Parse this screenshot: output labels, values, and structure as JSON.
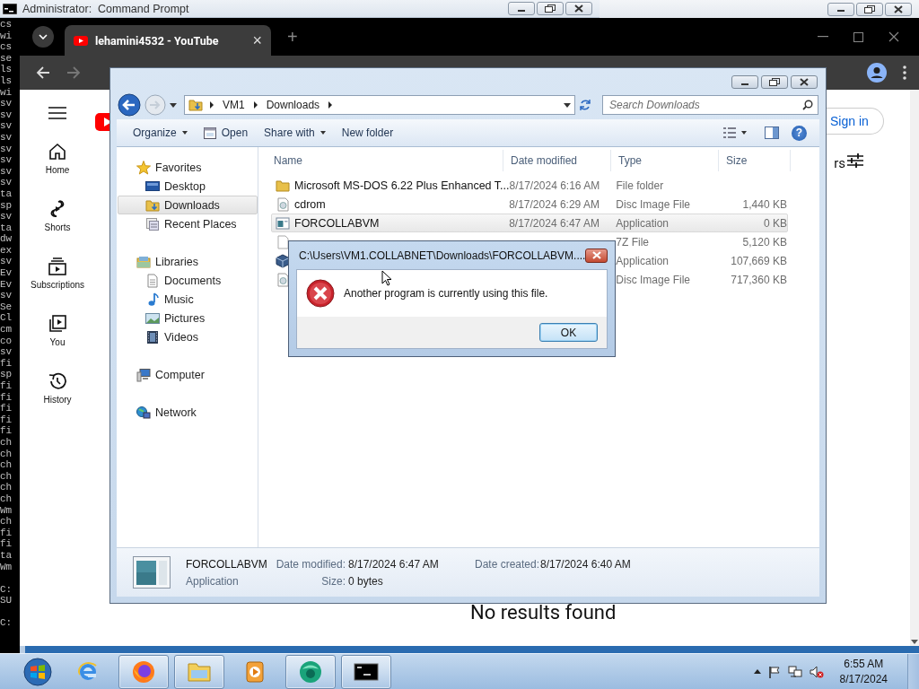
{
  "console": {
    "title": "Administrator:  Command Prompt",
    "lines": [
      {
        "text": "cs"
      },
      {
        "text": "wi"
      },
      {
        "text": "cs"
      },
      {
        "text": "se"
      },
      {
        "text": "ls"
      },
      {
        "text": "ls"
      },
      {
        "text": "wi"
      },
      {
        "text": "sv"
      },
      {
        "text": "sv"
      },
      {
        "text": "sv"
      },
      {
        "text": "sv"
      },
      {
        "text": "sv"
      },
      {
        "text": "sv"
      },
      {
        "text": "sv"
      },
      {
        "text": "sv"
      },
      {
        "text": "ta"
      },
      {
        "text": "sp"
      },
      {
        "text": "sv"
      },
      {
        "text": "ta"
      },
      {
        "text": "dw"
      },
      {
        "text": "ex"
      },
      {
        "text": "sv"
      },
      {
        "text": "Ev"
      },
      {
        "text": "Ev"
      },
      {
        "text": "sv"
      },
      {
        "text": "Se"
      },
      {
        "text": "Cl"
      },
      {
        "text": "cm"
      },
      {
        "text": "co"
      },
      {
        "text": "sv"
      },
      {
        "text": "fi"
      },
      {
        "text": "sp"
      },
      {
        "text": "fi"
      },
      {
        "text": "fi"
      },
      {
        "text": "fi"
      },
      {
        "text": "fi"
      },
      {
        "text": "fi"
      },
      {
        "text": "ch"
      },
      {
        "text": "ch"
      },
      {
        "text": "ch"
      },
      {
        "text": "ch"
      },
      {
        "text": "ch"
      },
      {
        "text": "ch"
      },
      {
        "text": "Wm"
      },
      {
        "text": "ch"
      },
      {
        "text": "fi"
      },
      {
        "text": "fi"
      },
      {
        "text": "ta"
      },
      {
        "text": "Wm"
      },
      {
        "text": "C:",
        "blank_before": true
      },
      {
        "text": "SU"
      },
      {
        "text": "C:",
        "blank_before": true
      }
    ]
  },
  "browser": {
    "tab": {
      "title": "lehamini4532 - YouTube",
      "close": "×"
    },
    "new_tab": "+",
    "sign_in": "Sign in",
    "filters": "rs",
    "sidebar": [
      {
        "kind": "home",
        "label": "Home"
      },
      {
        "kind": "shorts",
        "label": "Shorts"
      },
      {
        "kind": "subscriptions",
        "label": "Subscriptions"
      },
      {
        "kind": "you",
        "label": "You"
      },
      {
        "kind": "history",
        "label": "History"
      }
    ],
    "message": "No results found"
  },
  "explorer": {
    "breadcrumb": [
      "VM1",
      "Downloads"
    ],
    "search": {
      "placeholder": "Search Downloads"
    },
    "toolbar": [
      {
        "kind": "menu",
        "label": "Organize",
        "dropdown": true
      },
      {
        "kind": "open",
        "label": "Open",
        "dropdown": false
      },
      {
        "kind": "menu",
        "label": "Share with",
        "dropdown": true
      },
      {
        "kind": "menu",
        "label": "New folder",
        "dropdown": false
      }
    ],
    "help": "?",
    "nav": [
      {
        "kind": "star",
        "label": "Favorites",
        "selected": false,
        "children": [
          {
            "kind": "desktop",
            "label": "Desktop",
            "selected": false
          },
          {
            "kind": "downloads",
            "label": "Downloads",
            "selected": true
          },
          {
            "kind": "recent",
            "label": "Recent Places",
            "selected": false
          }
        ]
      },
      {
        "kind": "library",
        "label": "Libraries",
        "selected": false,
        "children": [
          {
            "kind": "documents",
            "label": "Documents",
            "selected": false
          },
          {
            "kind": "music",
            "label": "Music",
            "selected": false
          },
          {
            "kind": "pictures",
            "label": "Pictures",
            "selected": false
          },
          {
            "kind": "videos",
            "label": "Videos",
            "selected": false
          }
        ]
      },
      {
        "kind": "computer",
        "label": "Computer",
        "selected": false
      },
      {
        "kind": "network",
        "label": "Network",
        "selected": false
      }
    ],
    "columns": [
      "Name",
      "Date modified",
      "Type",
      "Size"
    ],
    "files": [
      {
        "kind": "folder",
        "name": "Microsoft MS-DOS 6.22 Plus Enhanced T...",
        "date": "8/17/2024 6:16 AM",
        "type": "File folder",
        "selected": false
      },
      {
        "kind": "disc",
        "name": "cdrom",
        "date": "8/17/2024 6:29 AM",
        "type": "Disc Image File",
        "size": "1,440 KB",
        "selected": false
      },
      {
        "kind": "app",
        "name": "FORCOLLABVM",
        "date": "8/17/2024 6:47 AM",
        "type": "Application",
        "size": "0 KB",
        "selected": true
      },
      {
        "kind": "archive",
        "type": "7Z File",
        "size": "5,120 KB",
        "selected": false
      },
      {
        "kind": "package",
        "type": "Application",
        "size": "107,669 KB",
        "selected": false
      },
      {
        "kind": "disc",
        "type": "Disc Image File",
        "size": "717,360 KB",
        "selected": false
      }
    ],
    "details": {
      "name": "FORCOLLABVM",
      "type": "Application",
      "fields": [
        {
          "label": "Date modified:",
          "value": "8/17/2024 6:47 AM"
        },
        {
          "label": "Date created:",
          "value": "8/17/2024 6:40 AM"
        },
        {
          "label": "Size:",
          "value": "0 bytes"
        }
      ]
    }
  },
  "dialog": {
    "title": "C:\\Users\\VM1.COLLABNET\\Downloads\\FORCOLLABVM....",
    "message": "Another program is currently using this file.",
    "button": "OK"
  },
  "taskbar": {
    "apps": [
      {
        "kind": "ie",
        "running": false
      },
      {
        "kind": "firefox",
        "running": true
      },
      {
        "kind": "explorer",
        "running": true
      },
      {
        "kind": "media",
        "running": false
      },
      {
        "kind": "globe",
        "running": true
      },
      {
        "kind": "console",
        "running": true
      }
    ],
    "clock": {
      "time": "6:55 AM",
      "date": "8/17/2024"
    }
  }
}
